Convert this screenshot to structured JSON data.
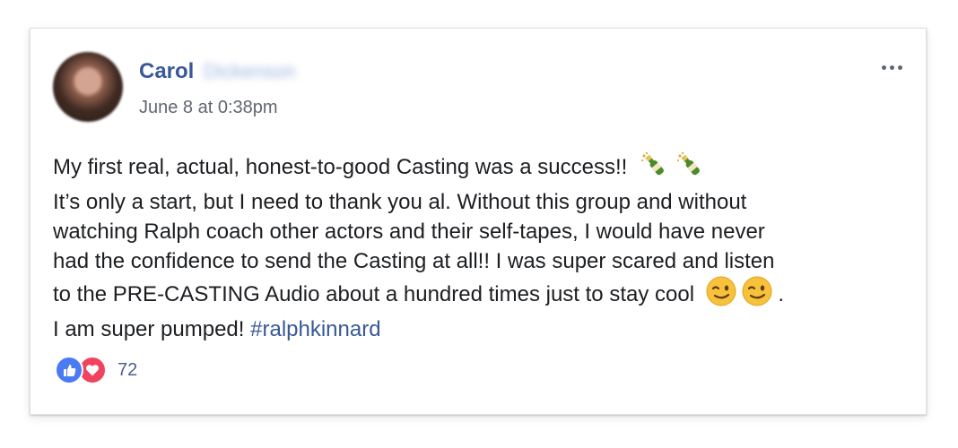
{
  "post": {
    "author_name": "Carol",
    "author_surname_blurred": "Dickenson",
    "timestamp": "June 8 at 0:38pm",
    "more_icon": "more-horizontal-icon",
    "lines": [
      "My first real, actual, honest-to-good Casting was a success!!",
      "It’s only a start, but I need to thank you al. Without this group and without",
      "watching Ralph coach other actors and their self-tapes, I would have never",
      "had the confidence to send the Casting at all!! I was super scared and listen",
      "to the PRE-CASTING Audio about a hundred times just to stay cool",
      "I am super pumped!"
    ],
    "line5_suffix": ".",
    "hashtag": "#ralphkinnard",
    "emojis": {
      "line1": [
        "champagne-icon",
        "champagne-icon"
      ],
      "line5": [
        "winking-face-icon",
        "winking-face-icon"
      ]
    }
  },
  "reactions": {
    "icons": [
      "like-icon",
      "love-icon"
    ],
    "count": "72"
  },
  "colors": {
    "link_blue": "#385898",
    "like_blue": "#4b7bf2",
    "love_red": "#f0445e",
    "text": "#1c1e21",
    "muted": "#616770"
  }
}
